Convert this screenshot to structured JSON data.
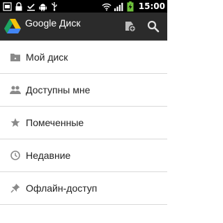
{
  "status_bar": {
    "time": "15:00",
    "left_icons": [
      "usb-debug-icon",
      "lock-icon",
      "download-done-icon",
      "android-icon",
      "usb-icon"
    ],
    "right_icons": [
      "wifi-icon",
      "signal-icon",
      "battery-charging-icon"
    ]
  },
  "app_bar": {
    "title": "Google Диск",
    "actions": [
      "drive-add-icon",
      "search-icon"
    ]
  },
  "nav": {
    "items": [
      {
        "label": "Мой диск",
        "icon": "folder-icon"
      },
      {
        "label": "Доступны мне",
        "icon": "people-icon"
      },
      {
        "label": "Помеченные",
        "icon": "star-icon"
      },
      {
        "label": "Недавние",
        "icon": "clock-icon"
      },
      {
        "label": "Офлайн-доступ",
        "icon": "pin-icon"
      }
    ]
  },
  "colors": {
    "status_bar_bg": "#000000",
    "action_bar_bg": "#2b2b2b",
    "list_bg": "#ffffff",
    "divider": "#d9d9d9",
    "icon_gray": "#8a8a8a",
    "battery_green": "#6ec13b"
  }
}
